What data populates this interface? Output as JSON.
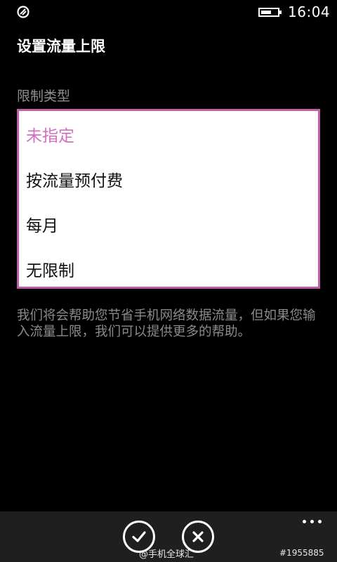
{
  "status_bar": {
    "time": "16:04",
    "battery_icon": "battery-icon",
    "app_icon": "signal-app-icon"
  },
  "page": {
    "title": "设置流量上限"
  },
  "limit_type": {
    "label": "限制类型",
    "options": [
      "未指定",
      "按流量预付费",
      "每月",
      "无限制"
    ],
    "selected_index": 0
  },
  "help_text": "我们将会帮助您节省手机网络数据流量，但如果您输入流量上限，我们可以提供更多的帮助。",
  "app_bar": {
    "confirm_icon": "check-icon",
    "cancel_icon": "close-icon",
    "more_icon": "more-dots-icon"
  },
  "watermark": {
    "text": "@手机全球汇",
    "id": "#1955885"
  },
  "colors": {
    "accent": "#d66ec0",
    "border_accent": "#c060a8",
    "background": "#000000",
    "muted_text": "#8a8a8a"
  }
}
